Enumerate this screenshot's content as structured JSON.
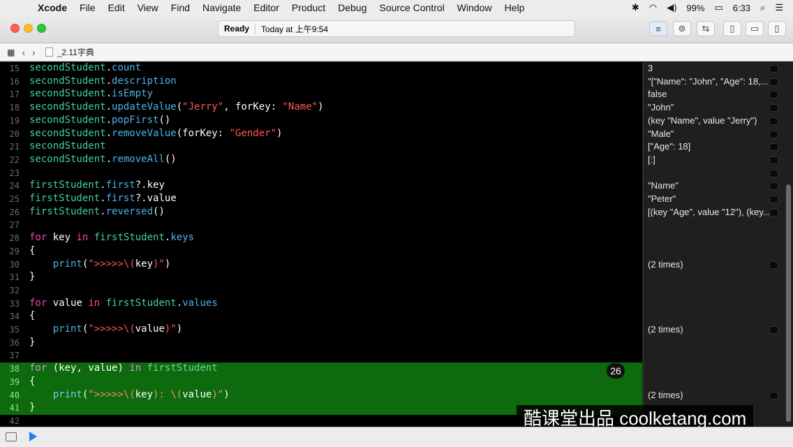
{
  "menubar": {
    "apple": "",
    "items": [
      "Xcode",
      "File",
      "Edit",
      "View",
      "Find",
      "Navigate",
      "Editor",
      "Product",
      "Debug",
      "Source Control",
      "Window",
      "Help"
    ],
    "battery": "99%",
    "clock": "6:33"
  },
  "toolbar": {
    "status_ready": "Ready",
    "status_time": "Today at 上午9:54"
  },
  "jumpbar": {
    "filename": "_2.11字典"
  },
  "editor": {
    "lines": [
      {
        "num": "15",
        "code": [
          [
            "var",
            "secondStudent"
          ],
          [
            "plain",
            "."
          ],
          [
            "mem",
            "count"
          ]
        ]
      },
      {
        "num": "16",
        "code": [
          [
            "var",
            "secondStudent"
          ],
          [
            "plain",
            "."
          ],
          [
            "mem",
            "description"
          ]
        ]
      },
      {
        "num": "17",
        "code": [
          [
            "var",
            "secondStudent"
          ],
          [
            "plain",
            "."
          ],
          [
            "mem",
            "isEmpty"
          ]
        ]
      },
      {
        "num": "18",
        "code": [
          [
            "var",
            "secondStudent"
          ],
          [
            "plain",
            "."
          ],
          [
            "mem",
            "updateValue"
          ],
          [
            "plain",
            "("
          ],
          [
            "str",
            "\"Jerry\""
          ],
          [
            "plain",
            ", forKey: "
          ],
          [
            "str",
            "\"Name\""
          ],
          [
            "plain",
            ")"
          ]
        ]
      },
      {
        "num": "19",
        "code": [
          [
            "var",
            "secondStudent"
          ],
          [
            "plain",
            "."
          ],
          [
            "mem",
            "popFirst"
          ],
          [
            "plain",
            "()"
          ]
        ]
      },
      {
        "num": "20",
        "code": [
          [
            "var",
            "secondStudent"
          ],
          [
            "plain",
            "."
          ],
          [
            "mem",
            "removeValue"
          ],
          [
            "plain",
            "(forKey: "
          ],
          [
            "str",
            "\"Gender\""
          ],
          [
            "plain",
            ")"
          ]
        ]
      },
      {
        "num": "21",
        "code": [
          [
            "var",
            "secondStudent"
          ]
        ]
      },
      {
        "num": "22",
        "code": [
          [
            "var",
            "secondStudent"
          ],
          [
            "plain",
            "."
          ],
          [
            "mem",
            "removeAll"
          ],
          [
            "plain",
            "()"
          ]
        ]
      },
      {
        "num": "23",
        "code": []
      },
      {
        "num": "24",
        "code": [
          [
            "var",
            "firstStudent"
          ],
          [
            "plain",
            "."
          ],
          [
            "mem",
            "first"
          ],
          [
            "plain",
            "?.key"
          ]
        ]
      },
      {
        "num": "25",
        "code": [
          [
            "var",
            "firstStudent"
          ],
          [
            "plain",
            "."
          ],
          [
            "mem",
            "first"
          ],
          [
            "plain",
            "?.value"
          ]
        ]
      },
      {
        "num": "26",
        "code": [
          [
            "var",
            "firstStudent"
          ],
          [
            "plain",
            "."
          ],
          [
            "mem",
            "reversed"
          ],
          [
            "plain",
            "()"
          ]
        ]
      },
      {
        "num": "27",
        "code": []
      },
      {
        "num": "28",
        "code": [
          [
            "kw",
            "for"
          ],
          [
            "plain",
            " key "
          ],
          [
            "kw",
            "in"
          ],
          [
            "plain",
            " "
          ],
          [
            "var",
            "firstStudent"
          ],
          [
            "plain",
            "."
          ],
          [
            "mem",
            "keys"
          ]
        ]
      },
      {
        "num": "29",
        "code": [
          [
            "plain",
            "{"
          ]
        ]
      },
      {
        "num": "30",
        "code": [
          [
            "plain",
            "    "
          ],
          [
            "mem",
            "print"
          ],
          [
            "plain",
            "("
          ],
          [
            "str",
            "\">>>>>\\("
          ],
          [
            "plain",
            "key"
          ],
          [
            "str",
            ")\""
          ],
          [
            "plain",
            ")"
          ]
        ]
      },
      {
        "num": "31",
        "code": [
          [
            "plain",
            "}"
          ]
        ]
      },
      {
        "num": "32",
        "code": []
      },
      {
        "num": "33",
        "code": [
          [
            "kw",
            "for"
          ],
          [
            "plain",
            " value "
          ],
          [
            "kw",
            "in"
          ],
          [
            "plain",
            " "
          ],
          [
            "var",
            "firstStudent"
          ],
          [
            "plain",
            "."
          ],
          [
            "mem",
            "values"
          ]
        ]
      },
      {
        "num": "34",
        "code": [
          [
            "plain",
            "{"
          ]
        ]
      },
      {
        "num": "35",
        "code": [
          [
            "plain",
            "    "
          ],
          [
            "mem",
            "print"
          ],
          [
            "plain",
            "("
          ],
          [
            "str",
            "\">>>>>\\("
          ],
          [
            "plain",
            "value"
          ],
          [
            "str",
            ")\""
          ],
          [
            "plain",
            ")"
          ]
        ]
      },
      {
        "num": "36",
        "code": [
          [
            "plain",
            "}"
          ]
        ]
      },
      {
        "num": "37",
        "code": []
      },
      {
        "num": "38",
        "hl": true,
        "code": [
          [
            "kw",
            "for"
          ],
          [
            "plain",
            " (key, value) "
          ],
          [
            "kw",
            "in"
          ],
          [
            "plain",
            " "
          ],
          [
            "var",
            "firstStudent"
          ]
        ]
      },
      {
        "num": "39",
        "hl": true,
        "code": [
          [
            "plain",
            "{"
          ]
        ]
      },
      {
        "num": "40",
        "hl": true,
        "code": [
          [
            "plain",
            "    "
          ],
          [
            "mem",
            "print"
          ],
          [
            "plain",
            "("
          ],
          [
            "str",
            "\">>>>>\\("
          ],
          [
            "plain",
            "key"
          ],
          [
            "str",
            "): \\("
          ],
          [
            "plain",
            "value"
          ],
          [
            "str",
            ")\""
          ],
          [
            "plain",
            ")"
          ]
        ]
      },
      {
        "num": "41",
        "hl": true,
        "code": [
          [
            "plain",
            "}"
          ]
        ]
      },
      {
        "num": "42",
        "code": []
      }
    ],
    "badge": "26"
  },
  "results": [
    {
      "line": 0,
      "text": "3"
    },
    {
      "line": 1,
      "text": "\"[\"Name\": \"John\", \"Age\": 18,..."
    },
    {
      "line": 2,
      "text": "false"
    },
    {
      "line": 3,
      "text": "\"John\""
    },
    {
      "line": 4,
      "text": "(key \"Name\", value \"Jerry\")"
    },
    {
      "line": 5,
      "text": "\"Male\""
    },
    {
      "line": 6,
      "text": "[\"Age\": 18]"
    },
    {
      "line": 7,
      "text": "[:]"
    },
    {
      "line": 9,
      "text": "\"Name\""
    },
    {
      "line": 10,
      "text": "\"Peter\""
    },
    {
      "line": 11,
      "text": "[(key \"Age\", value \"12\"), (key..."
    },
    {
      "line": 15,
      "text": "(2 times)"
    },
    {
      "line": 20,
      "text": "(2 times)"
    },
    {
      "line": 25,
      "text": "(2 times)"
    }
  ],
  "watermark": "酷课堂出品 coolketang.com"
}
